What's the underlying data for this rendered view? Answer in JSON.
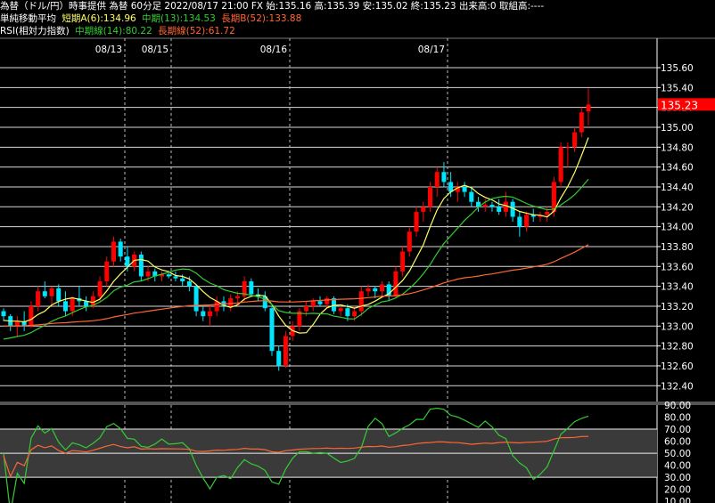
{
  "header": {
    "line1": "為替（ドル/円）時事提供 為替 60分足 2022/08/17 21:00 FX 始:135.16 高:135.39 安:135.02 終:135.23 出来高:0 取組高:----",
    "ma_title": "単純移動平均",
    "ma_short": "短期A(6):134.96",
    "ma_mid": "中期(13):134.53",
    "ma_long": "長期B(52):133.88",
    "rsi_title": "RSI(相対力指数)",
    "rsi_mid": "中期線(14):80.22",
    "rsi_long": "長期線(52):61.72"
  },
  "colors": {
    "up": "#ff0000",
    "down": "#00e5ff",
    "ma_short": "#ffff66",
    "ma_mid": "#33cc33",
    "ma_long": "#ff6633",
    "price_box": "#ff0000",
    "rsi_band": "#3a3a3a"
  },
  "chart_data": [
    {
      "type": "candlestick",
      "y_ticks": [
        "135.60",
        "135.40",
        "135.20",
        "135.00",
        "134.80",
        "134.60",
        "134.40",
        "134.20",
        "134.00",
        "133.80",
        "133.60",
        "133.40",
        "133.20",
        "133.00",
        "132.80",
        "132.60",
        "132.40"
      ],
      "ylim": [
        132.3,
        135.7
      ],
      "date_labels": [
        "08/13",
        "08/15",
        "08/16",
        "08/17"
      ],
      "last_price": "135.23",
      "series": [
        {
          "name": "短期A(6)"
        },
        {
          "name": "中期(13)"
        },
        {
          "name": "長期B(52)"
        }
      ],
      "candles": [
        [
          133.15,
          133.18,
          133.05,
          133.1
        ],
        [
          133.1,
          133.12,
          132.95,
          133.0
        ],
        [
          133.0,
          133.1,
          132.9,
          133.05
        ],
        [
          133.05,
          133.15,
          132.95,
          133.0
        ],
        [
          133.0,
          133.25,
          132.98,
          133.2
        ],
        [
          133.2,
          133.4,
          133.15,
          133.35
        ],
        [
          133.35,
          133.45,
          133.28,
          133.3
        ],
        [
          133.3,
          133.4,
          133.22,
          133.38
        ],
        [
          133.38,
          133.42,
          133.2,
          133.25
        ],
        [
          133.25,
          133.35,
          133.1,
          133.15
        ],
        [
          133.15,
          133.3,
          133.1,
          133.28
        ],
        [
          133.28,
          133.4,
          133.2,
          133.25
        ],
        [
          133.25,
          133.3,
          133.15,
          133.2
        ],
        [
          133.2,
          133.35,
          133.18,
          133.3
        ],
        [
          133.3,
          133.5,
          133.25,
          133.45
        ],
        [
          133.45,
          133.7,
          133.4,
          133.65
        ],
        [
          133.65,
          133.9,
          133.6,
          133.85
        ],
        [
          133.85,
          133.88,
          133.65,
          133.7
        ],
        [
          133.7,
          133.8,
          133.55,
          133.6
        ],
        [
          133.6,
          133.75,
          133.55,
          133.72
        ],
        [
          133.72,
          133.75,
          133.45,
          133.5
        ],
        [
          133.5,
          133.6,
          133.45,
          133.55
        ],
        [
          133.55,
          133.58,
          133.45,
          133.5
        ],
        [
          133.5,
          133.55,
          133.45,
          133.52
        ],
        [
          133.52,
          133.55,
          133.48,
          133.5
        ],
        [
          133.5,
          133.55,
          133.45,
          133.48
        ],
        [
          133.48,
          133.52,
          133.4,
          133.45
        ],
        [
          133.45,
          133.5,
          133.35,
          133.4
        ],
        [
          133.4,
          133.42,
          133.1,
          133.15
        ],
        [
          133.15,
          133.2,
          133.05,
          133.1
        ],
        [
          133.1,
          133.2,
          133.0,
          133.15
        ],
        [
          133.15,
          133.3,
          133.1,
          133.25
        ],
        [
          133.25,
          133.3,
          133.15,
          133.2
        ],
        [
          133.2,
          133.32,
          133.15,
          133.28
        ],
        [
          133.28,
          133.35,
          133.2,
          133.3
        ],
        [
          133.3,
          133.5,
          133.25,
          133.45
        ],
        [
          133.45,
          133.48,
          133.3,
          133.32
        ],
        [
          133.32,
          133.38,
          133.25,
          133.3
        ],
        [
          133.3,
          133.35,
          133.15,
          133.18
        ],
        [
          133.18,
          133.2,
          132.7,
          132.75
        ],
        [
          132.75,
          132.8,
          132.55,
          132.6
        ],
        [
          132.6,
          132.95,
          132.58,
          132.9
        ],
        [
          132.9,
          133.05,
          132.85,
          133.0
        ],
        [
          133.0,
          133.18,
          132.95,
          133.15
        ],
        [
          133.15,
          133.25,
          133.1,
          133.2
        ],
        [
          133.2,
          133.28,
          133.15,
          133.25
        ],
        [
          133.25,
          133.3,
          133.2,
          133.22
        ],
        [
          133.22,
          133.3,
          133.18,
          133.28
        ],
        [
          133.28,
          133.3,
          133.12,
          133.15
        ],
        [
          133.15,
          133.2,
          133.1,
          133.18
        ],
        [
          133.18,
          133.22,
          133.05,
          133.1
        ],
        [
          133.1,
          133.2,
          133.05,
          133.15
        ],
        [
          133.15,
          133.4,
          133.1,
          133.35
        ],
        [
          133.35,
          133.42,
          133.3,
          133.38
        ],
        [
          133.38,
          133.4,
          133.28,
          133.35
        ],
        [
          133.35,
          133.45,
          133.3,
          133.42
        ],
        [
          133.42,
          133.45,
          133.25,
          133.3
        ],
        [
          133.3,
          133.6,
          133.28,
          133.55
        ],
        [
          133.55,
          133.8,
          133.5,
          133.75
        ],
        [
          133.75,
          134.0,
          133.7,
          133.95
        ],
        [
          133.95,
          134.2,
          133.9,
          134.15
        ],
        [
          134.15,
          134.25,
          134.05,
          134.2
        ],
        [
          134.2,
          134.45,
          134.15,
          134.4
        ],
        [
          134.4,
          134.6,
          134.3,
          134.55
        ],
        [
          134.55,
          134.65,
          134.4,
          134.45
        ],
        [
          134.45,
          134.55,
          134.3,
          134.35
        ],
        [
          134.35,
          134.45,
          134.25,
          134.4
        ],
        [
          134.4,
          134.45,
          134.3,
          134.35
        ],
        [
          134.35,
          134.4,
          134.2,
          134.25
        ],
        [
          134.25,
          134.3,
          134.15,
          134.2
        ],
        [
          134.2,
          134.28,
          134.15,
          134.22
        ],
        [
          134.22,
          134.25,
          134.15,
          134.2
        ],
        [
          134.2,
          134.28,
          134.12,
          134.15
        ],
        [
          134.15,
          134.35,
          134.1,
          134.25
        ],
        [
          134.25,
          134.28,
          134.05,
          134.1
        ],
        [
          134.1,
          134.15,
          133.9,
          134.0
        ],
        [
          134.0,
          134.15,
          133.95,
          134.12
        ],
        [
          134.12,
          134.18,
          134.05,
          134.1
        ],
        [
          134.1,
          134.15,
          134.05,
          134.12
        ],
        [
          134.12,
          134.2,
          134.05,
          134.15
        ],
        [
          134.15,
          134.5,
          134.1,
          134.45
        ],
        [
          134.45,
          134.85,
          134.4,
          134.8
        ],
        [
          134.8,
          134.85,
          134.6,
          134.8
        ],
        [
          134.8,
          135.0,
          134.75,
          134.95
        ],
        [
          134.95,
          135.2,
          134.9,
          135.15
        ],
        [
          135.16,
          135.39,
          135.02,
          135.23
        ]
      ]
    },
    {
      "type": "line",
      "y_ticks": [
        "90.00",
        "80.00",
        "70.00",
        "60.00",
        "50.00",
        "40.00",
        "30.00",
        "20.00",
        "10.00"
      ],
      "ylim": [
        10,
        90
      ],
      "bands": [
        [
          30,
          70
        ],
        [
          50,
          50
        ]
      ],
      "series": [
        {
          "name": "中期線(14)",
          "last": 80.22
        },
        {
          "name": "長期線(52)",
          "last": 61.72
        }
      ]
    }
  ]
}
